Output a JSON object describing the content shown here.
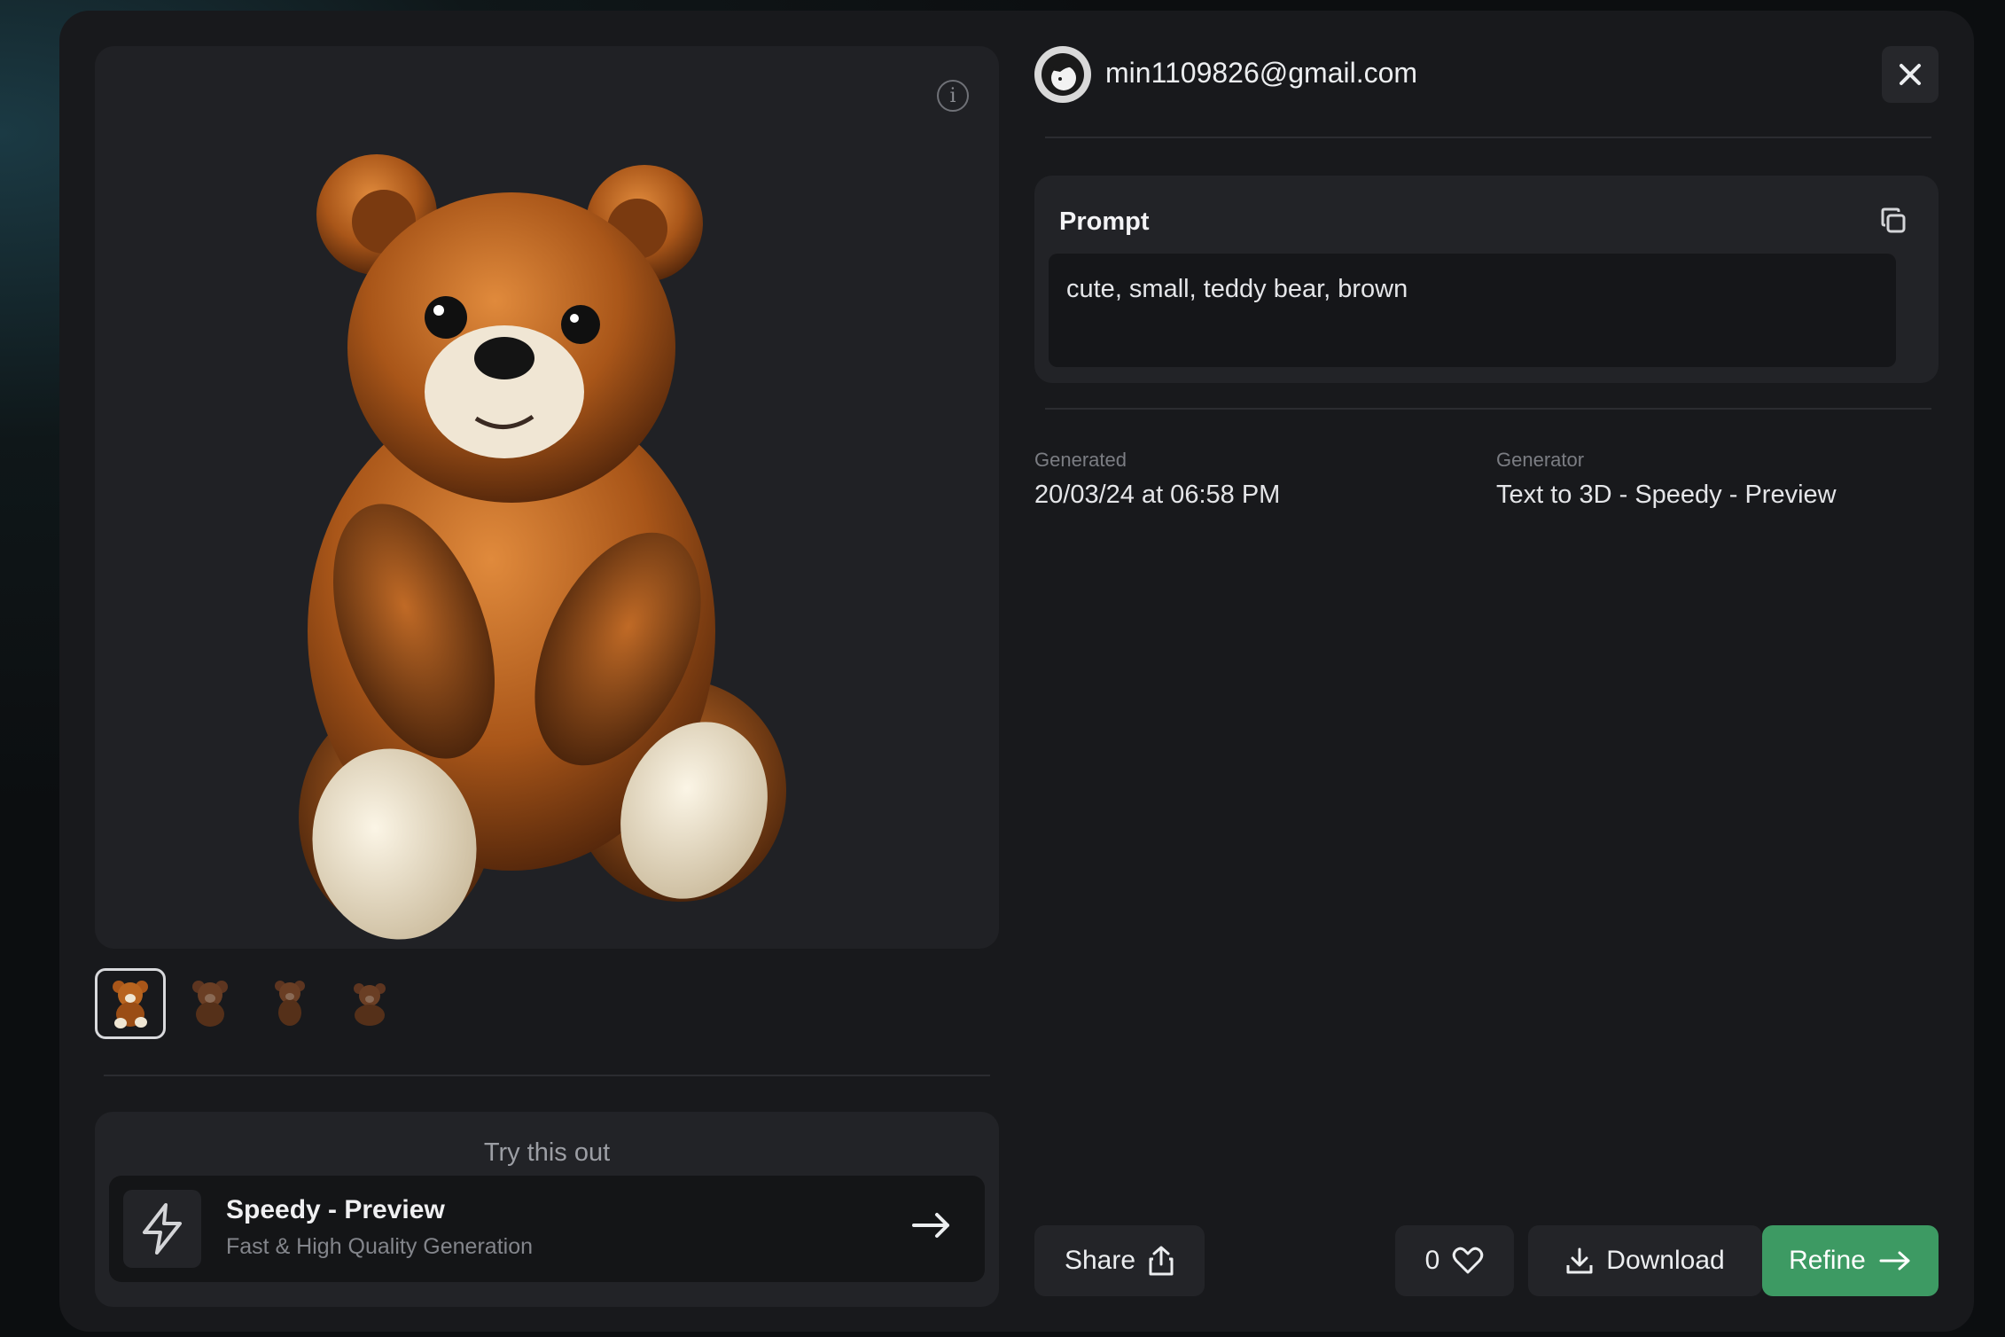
{
  "viewer": {
    "info_icon": "info-circle-icon",
    "thumbnails": [
      {
        "name": "teddy-bear-thumbnail-1",
        "active": true
      },
      {
        "name": "teddy-bear-thumbnail-2",
        "active": false
      },
      {
        "name": "teddy-bear-thumbnail-3",
        "active": false
      },
      {
        "name": "teddy-bear-thumbnail-4",
        "active": false
      }
    ]
  },
  "try_this_out": {
    "title": "Try this out",
    "item": {
      "name": "Speedy - Preview",
      "subtitle": "Fast & High Quality Generation",
      "icon": "lightning-bolt-icon",
      "arrow_icon": "arrow-right-icon"
    }
  },
  "user": {
    "email": "min1109826@gmail.com"
  },
  "prompt": {
    "label": "Prompt",
    "text": "cute, small, teddy bear, brown",
    "copy_icon": "copy-icon"
  },
  "meta": {
    "generated_label": "Generated",
    "generated_value": "20/03/24 at 06:58 PM",
    "generator_label": "Generator",
    "generator_value": "Text to 3D - Speedy - Preview"
  },
  "actions": {
    "share_label": "Share",
    "like_count": "0",
    "download_label": "Download",
    "refine_label": "Refine"
  },
  "colors": {
    "modal_bg": "#18191c",
    "panel_bg": "#222327",
    "accent_green": "#3d9a63"
  }
}
